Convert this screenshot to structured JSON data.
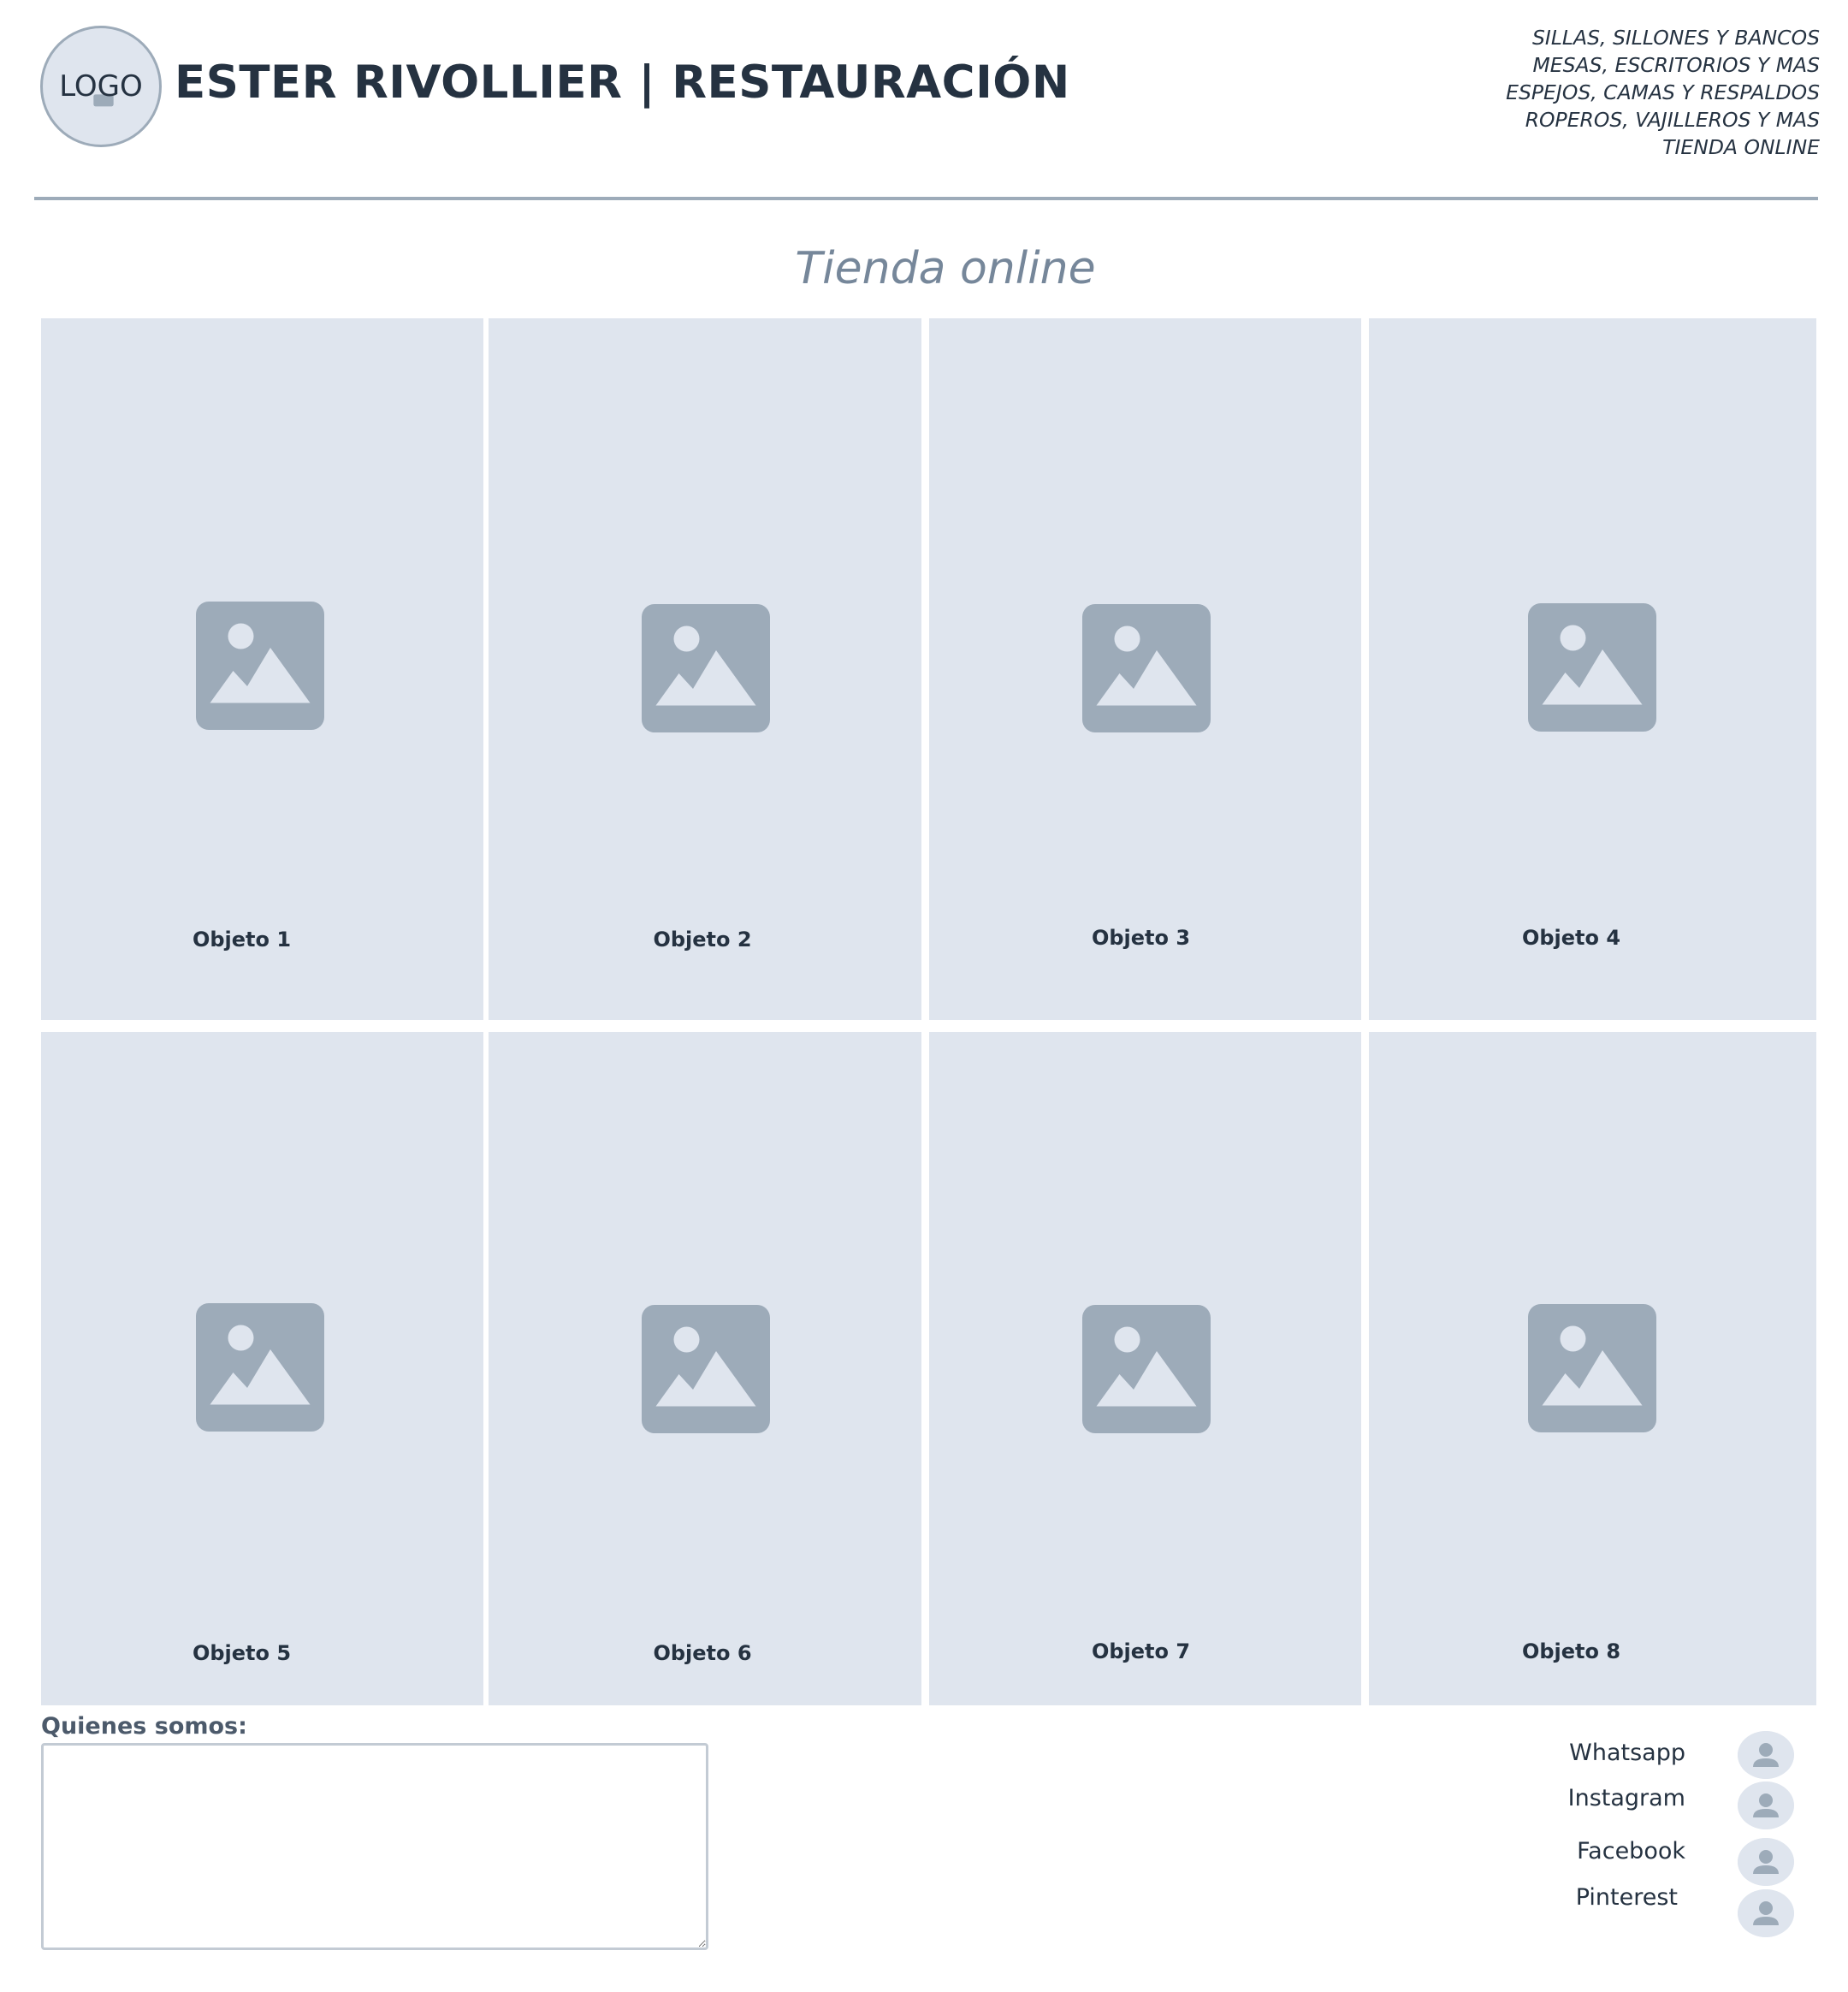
{
  "header": {
    "logo_text": "LOGO",
    "title": "ESTER RIVOLLIER | RESTAURACIÓN",
    "nav": [
      "SILLAS, SILLONES Y BANCOS",
      "MESAS, ESCRITORIOS Y MAS",
      "ESPEJOS, CAMAS Y RESPALDOS",
      "ROPEROS, VAJILLEROS Y MAS",
      "TIENDA ONLINE"
    ]
  },
  "main": {
    "section_title": "Tienda online",
    "products": [
      "Objeto 1",
      "Objeto 2",
      "Objeto 3",
      "Objeto 4",
      "Objeto 5",
      "Objeto 6",
      "Objeto 7",
      "Objeto 8"
    ]
  },
  "footer": {
    "about_label": "Quienes somos:",
    "about_value": "",
    "social": [
      "Whatsapp",
      "Instagram",
      "Facebook",
      "Pinterest"
    ]
  },
  "colors": {
    "text": "#253241",
    "muted": "#76879a",
    "placeholder_bg": "#dfe5ee",
    "icon": "#9dabb9"
  },
  "icons": {
    "product_placeholder": "image-placeholder-icon",
    "social_avatar": "user-icon"
  }
}
